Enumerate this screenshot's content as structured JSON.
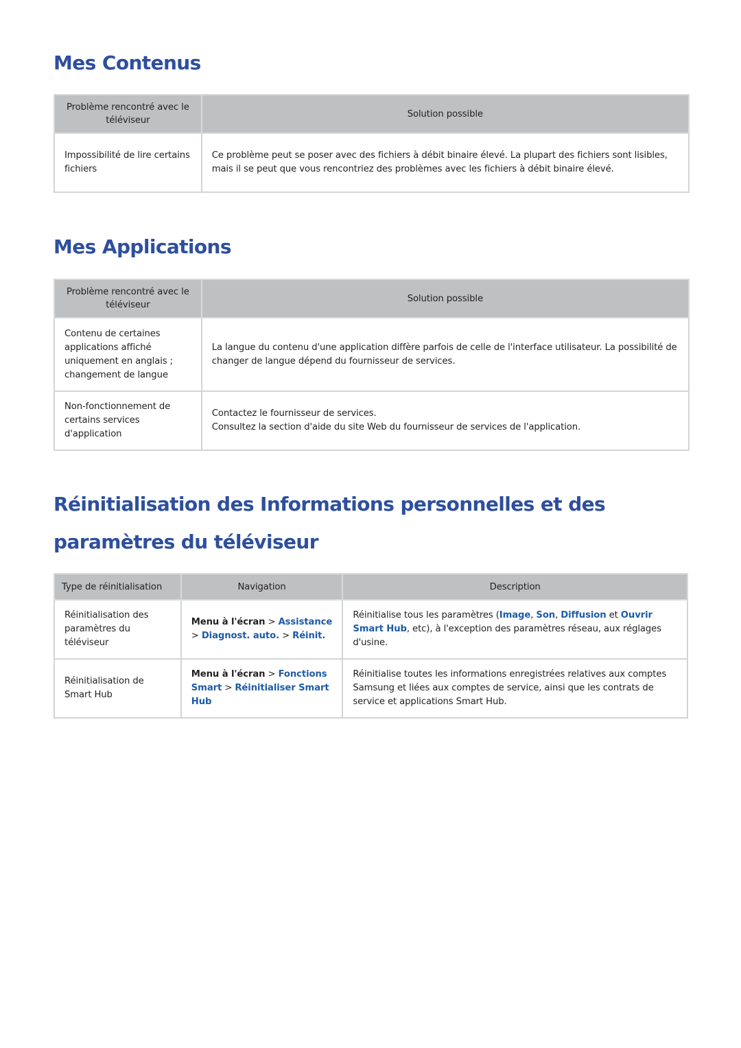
{
  "sections": {
    "mes_contenus": {
      "title": "Mes Contenus",
      "headers": [
        "Problème rencontré avec le téléviseur",
        "Solution possible"
      ],
      "rows": [
        {
          "problem": "Impossibilité de lire certains fichiers",
          "solution": "Ce problème peut se poser avec des fichiers à débit binaire élevé. La plupart des fichiers sont lisibles, mais il se peut que vous rencontriez des problèmes avec les fichiers à débit binaire élevé."
        }
      ]
    },
    "mes_applications": {
      "title": "Mes Applications",
      "headers": [
        "Problème rencontré avec le téléviseur",
        "Solution possible"
      ],
      "rows": [
        {
          "problem": "Contenu de certaines applications affiché uniquement en anglais ; changement de langue",
          "solution": "La langue du contenu d'une application diffère parfois de celle de l'interface utilisateur. La possibilité de changer de langue dépend du fournisseur de services."
        },
        {
          "problem": "Non-fonctionnement de certains services d'application",
          "solution_line1": "Contactez le fournisseur de services.",
          "solution_line2": "Consultez la section d'aide du site Web du fournisseur de services de l'application."
        }
      ]
    },
    "reinitialisation": {
      "title_line1": "Réinitialisation des Informations personnelles et des",
      "title_line2": "paramètres du téléviseur",
      "headers": [
        "Type de réinitialisation",
        "Navigation",
        "Description"
      ],
      "rows": [
        {
          "type": "Réinitialisation des paramètres du téléviseur",
          "nav": {
            "root": "Menu à l'écran",
            "sep": ">",
            "path": [
              "Assistance",
              "Diagnost. auto.",
              "Réinit."
            ]
          },
          "description": {
            "prefix": "Réinitialise tous les paramètres (",
            "links": [
              "Image",
              "Son",
              "Diffusion",
              "Ouvrir Smart Hub"
            ],
            "comma": ", ",
            "and": " et ",
            "suffix": ", etc), à l'exception des paramètres réseau, aux réglages d'usine."
          }
        },
        {
          "type": "Réinitialisation de Smart Hub",
          "nav": {
            "root": "Menu à l'écran",
            "sep": ">",
            "path": [
              "Fonctions Smart",
              "Réinitialiser Smart Hub"
            ]
          },
          "description": "Réinitialise toutes les informations enregistrées relatives aux comptes Samsung et liées aux comptes de service, ainsi que les contrats de service et applications Smart Hub."
        }
      ]
    }
  },
  "colors": {
    "heading": "#2e4f9e",
    "link": "#1d5ba6",
    "table_header_bg": "#bfc0c2",
    "border": "#d3d4d6",
    "text": "#231f20"
  }
}
